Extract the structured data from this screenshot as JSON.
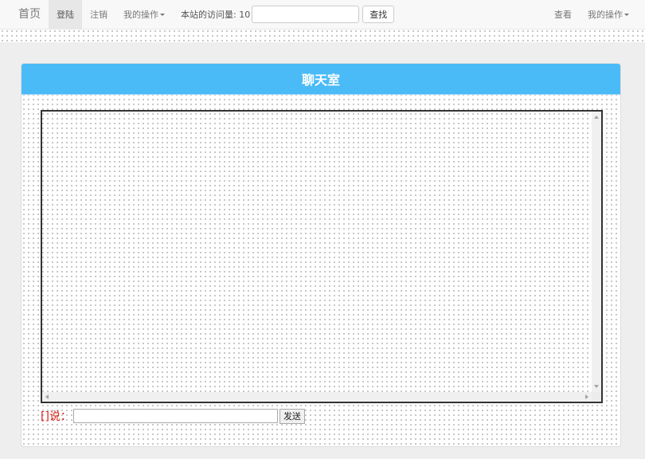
{
  "navbar": {
    "brand": "首页",
    "login": "登陆",
    "logout": "注销",
    "my_ops": "我的操作",
    "visit_label": "本站的访问量: 10",
    "search_value": "",
    "search_button": "查找",
    "view": "查看",
    "my_ops_right": "我的操作"
  },
  "panel": {
    "title": "聊天室"
  },
  "chat": {
    "messages": ""
  },
  "composer": {
    "say_label": "[]说：",
    "message_value": "",
    "send_button": "发送"
  },
  "colors": {
    "panel_heading": "#4abbf7",
    "say_label": "#e0231c"
  }
}
